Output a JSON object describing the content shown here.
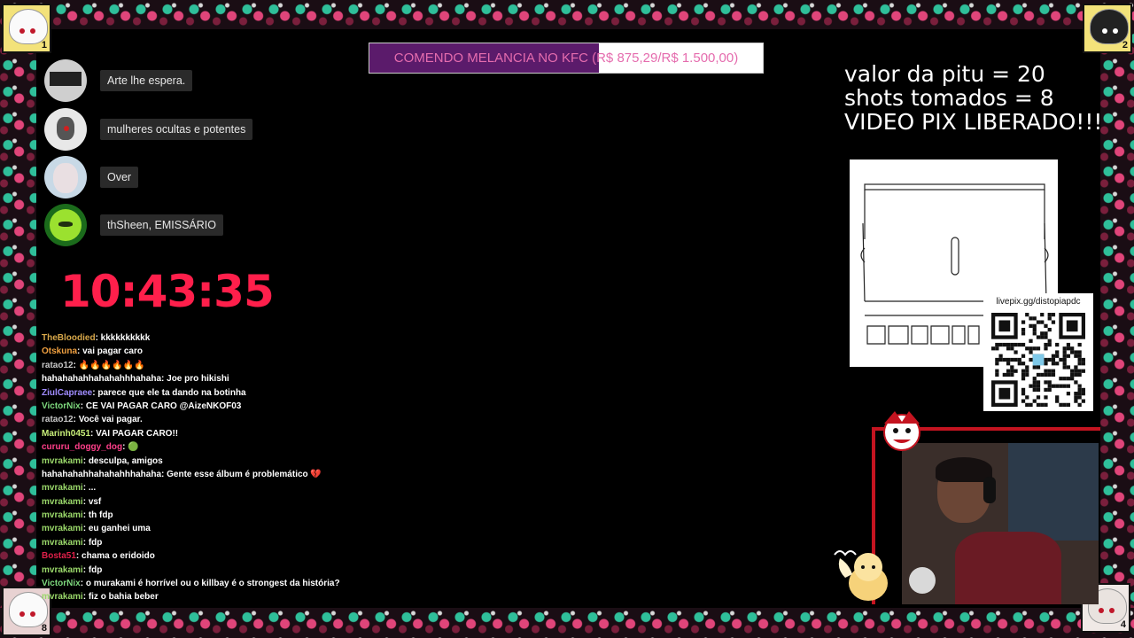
{
  "goal": {
    "text": "COMENDO MELANCIA NO KFC (R$ 875,29/R$ 1.500,00)",
    "progress_fraction": 0.5835
  },
  "list_items": [
    {
      "label": "Arte lhe espera."
    },
    {
      "label": "mulheres ocultas e potentes"
    },
    {
      "label": "Over"
    },
    {
      "label": "thSheen, EMISSÁRIO"
    }
  ],
  "clock": "10:43:35",
  "info": {
    "line1": "valor da pitu = 20",
    "line2": "shots tomados = 8",
    "line3": "VIDEO PIX LIBERADO!!!"
  },
  "qr": {
    "url": "livepix.gg/distopiapdc"
  },
  "corners": [
    "1",
    "2",
    "8",
    "4"
  ],
  "chat": [
    {
      "user": "TheBloodied",
      "color": "#d8a84a",
      "message": "kkkkkkkkkk"
    },
    {
      "user": "Otskuna",
      "color": "#f0a040",
      "message": "vai pagar caro"
    },
    {
      "user": "ratao12",
      "color": "#c8c8c8",
      "message": "🔥🔥🔥🔥🔥🔥"
    },
    {
      "user": "hahahahahhahahahhhahaha",
      "color": "#ffffff",
      "message": "Joe pro hikishi"
    },
    {
      "user": "ZiulCapraee",
      "color": "#a08cff",
      "message": "parece que ele ta dando na botinha"
    },
    {
      "user": "VictorNix",
      "color": "#7dd87d",
      "message": "CE VAI PAGAR CARO @AizeNKOF03"
    },
    {
      "user": "ratao12",
      "color": "#c8c8c8",
      "message": "Você vai pagar."
    },
    {
      "user": "Marinh0451",
      "color": "#c9f07a",
      "message": "VAI PAGAR CARO!!"
    },
    {
      "user": "cururu_doggy_dog",
      "color": "#ff3f8a",
      "message": "🟢"
    },
    {
      "user": "mvrakami",
      "color": "#9ad86a",
      "message": "desculpa, amigos"
    },
    {
      "user": "hahahahahhahahahhhahaha",
      "color": "#ffffff",
      "message": "Gente esse álbum é problemático 💔"
    },
    {
      "user": "mvrakami",
      "color": "#9ad86a",
      "message": "..."
    },
    {
      "user": "mvrakami",
      "color": "#9ad86a",
      "message": "vsf"
    },
    {
      "user": "mvrakami",
      "color": "#9ad86a",
      "message": "th fdp"
    },
    {
      "user": "mvrakami",
      "color": "#9ad86a",
      "message": "eu ganhei uma"
    },
    {
      "user": "mvrakami",
      "color": "#9ad86a",
      "message": "fdp"
    },
    {
      "user": "Bosta51",
      "color": "#e0204a",
      "message": "chama o eridoido"
    },
    {
      "user": "mvrakami",
      "color": "#9ad86a",
      "message": "fdp"
    },
    {
      "user": "VictorNix",
      "color": "#7dd87d",
      "message": "o murakami é horrível ou o killbay é o strongest da história?"
    },
    {
      "user": "mvrakami",
      "color": "#9ad86a",
      "message": "fiz o bahia beber"
    }
  ]
}
